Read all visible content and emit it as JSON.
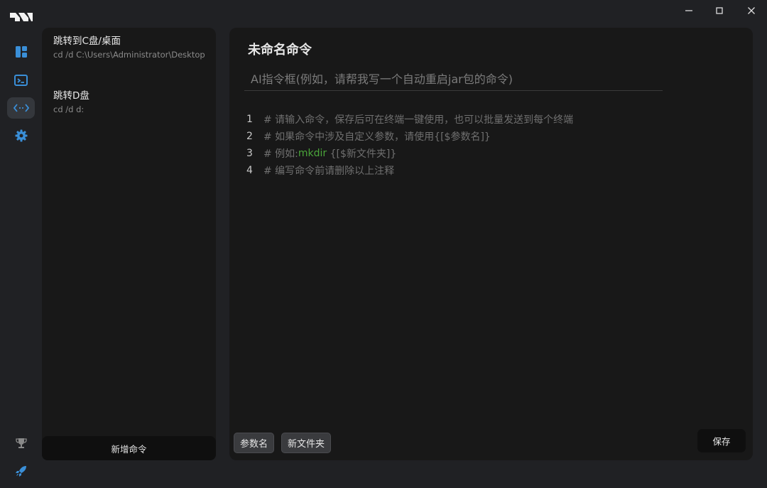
{
  "window": {
    "minimize_glyph": "—",
    "maximize_glyph": "□",
    "close_glyph": "✕"
  },
  "rail": {
    "items": [
      {
        "icon": "dashboard-icon"
      },
      {
        "icon": "terminal-icon"
      },
      {
        "icon": "code-icon",
        "active": true
      },
      {
        "icon": "settings-icon"
      },
      {
        "icon": "trophy-icon"
      },
      {
        "icon": "rocket-icon"
      }
    ],
    "accent": "#3a8fd8"
  },
  "commands": {
    "items": [
      {
        "title": "跳转到C盘/桌面",
        "body": "cd  /d C:\\Users\\Administrator\\Desktop"
      },
      {
        "title": "跳转D盘",
        "body": "cd /d d:"
      }
    ],
    "add_label": "新增命令"
  },
  "editor": {
    "title": "未命名命令",
    "ai_placeholder": "AI指令框(例如，请帮我写一个自动重启jar包的命令)",
    "lines": [
      {
        "num": "1",
        "comment": "# 请输入命令，保存后可在终端一键使用，也可以批量发送到每个终端"
      },
      {
        "num": "2",
        "comment": "# 如果命令中涉及自定义参数，请使用{[$参数名]}"
      },
      {
        "num": "3",
        "comment_prefix": "# 例如:",
        "keyword": "mkdir",
        "comment_suffix": " {[$新文件夹]}"
      },
      {
        "num": "4",
        "comment": "# 编写命令前请删除以上注释"
      }
    ],
    "chips": [
      "参数名",
      "新文件夹"
    ],
    "save_label": "保存"
  },
  "colors": {
    "keyword": "#4aa53a",
    "comment": "#6f6f6f",
    "accent": "#3a8fd8"
  }
}
